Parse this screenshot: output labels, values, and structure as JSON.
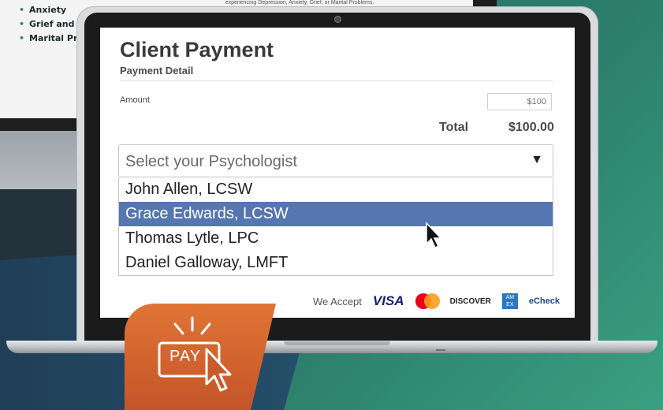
{
  "background": {
    "doc_bullets": [
      "Anxiety",
      "Grief and Lo",
      "Marital Prob"
    ],
    "doc_top_text": "experiencing Depression, Anxiety, Grief, or Marital Problems."
  },
  "form": {
    "title": "Client Payment",
    "subtitle": "Payment Detail",
    "amount_label": "Amount",
    "amount_value": "$100",
    "total_label": "Total",
    "total_value": "$100.00",
    "select_placeholder": "Select your Psychologist",
    "select_arrow_icon": "triangle-down-icon",
    "options": [
      {
        "label": "John Allen, LCSW",
        "selected": false
      },
      {
        "label": "Grace Edwards, LCSW",
        "selected": true
      },
      {
        "label": "Thomas Lytle, LPC",
        "selected": false
      },
      {
        "label": "Daniel Galloway, LMFT",
        "selected": false
      }
    ],
    "accept_label": "We Accept",
    "cards": {
      "visa": "VISA",
      "discover": "DISCOVER",
      "amex": "AM EX",
      "echeck": "eCheck"
    }
  },
  "badge": {
    "label": "PAY",
    "icon": "pay-click-icon"
  },
  "colors": {
    "selected_option": "#5576b0",
    "badge_orange": "#e07434"
  }
}
